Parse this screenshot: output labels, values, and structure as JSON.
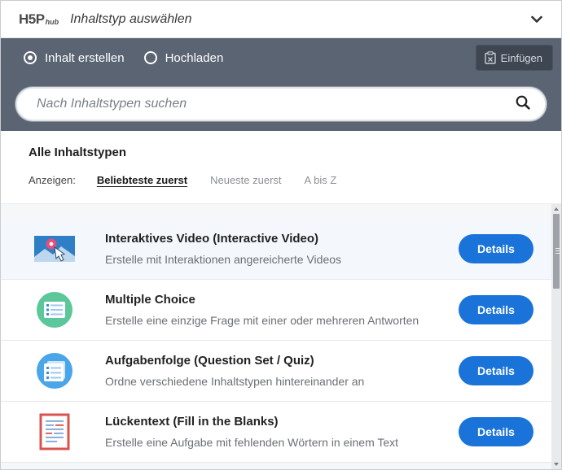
{
  "header": {
    "logo_main": "H5P",
    "logo_sub": "hub",
    "title": "Inhaltstyp auswählen",
    "toggle_icon": "chevron-down-icon"
  },
  "toolbar": {
    "create_label": "Inhalt erstellen",
    "upload_label": "Hochladen",
    "selected": "create",
    "paste_label": "Einfügen",
    "paste_icon": "clipboard-icon"
  },
  "search": {
    "placeholder": "Nach Inhaltstypen suchen",
    "value": "",
    "icon": "search-icon"
  },
  "filter": {
    "title": "Alle Inhaltstypen",
    "show_label": "Anzeigen:",
    "sort_options": [
      "Beliebteste zuerst",
      "Neueste zuerst",
      "A bis Z"
    ],
    "active_sort": "Beliebteste zuerst"
  },
  "content_types": [
    {
      "title": "Interaktives Video (Interactive Video)",
      "description": "Erstelle mit Interaktionen angereicherte Videos",
      "button": "Details",
      "icon": "interactive-video-icon"
    },
    {
      "title": "Multiple Choice",
      "description": "Erstelle eine einzige Frage mit einer oder mehreren Antworten",
      "button": "Details",
      "icon": "multiple-choice-icon"
    },
    {
      "title": "Aufgabenfolge (Question Set / Quiz)",
      "description": "Ordne verschiedene Inhaltstypen hintereinander an",
      "button": "Details",
      "icon": "question-set-icon"
    },
    {
      "title": "Lückentext (Fill in the Blanks)",
      "description": "Erstelle eine Aufgabe mit fehlenden Wörtern in einem Text",
      "button": "Details",
      "icon": "fill-in-the-blanks-icon"
    }
  ],
  "colors": {
    "toolbar_bg": "#5a6472",
    "accent": "#1a73d9",
    "paste_bg": "#3e4651"
  }
}
